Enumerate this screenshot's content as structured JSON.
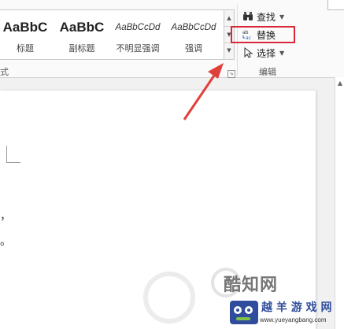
{
  "ribbon": {
    "styles_group": {
      "items": [
        {
          "sample": "AaBbC",
          "name": ""
        },
        {
          "sample": "AaBbC",
          "name": "标题"
        },
        {
          "sample": "AaBbC",
          "name": "副标题"
        },
        {
          "sample": "AaBbCcDd",
          "name": "不明显强调"
        },
        {
          "sample": "AaBbCcDd",
          "name": "强调"
        }
      ],
      "label": "式"
    },
    "editing_group": {
      "find": "查找",
      "replace": "替换",
      "select": "选择",
      "label": "编辑"
    }
  },
  "document": {
    "fragments": [
      "，",
      "。"
    ]
  },
  "watermark": {
    "brand1": "酷知网",
    "brand2": "越 羊 游 戏 网",
    "url": "www.yueyangbang.com"
  },
  "colors": {
    "highlight": "#d9283a",
    "arrow": "#e0403a",
    "watermark_blue": "#2f4d9c"
  }
}
